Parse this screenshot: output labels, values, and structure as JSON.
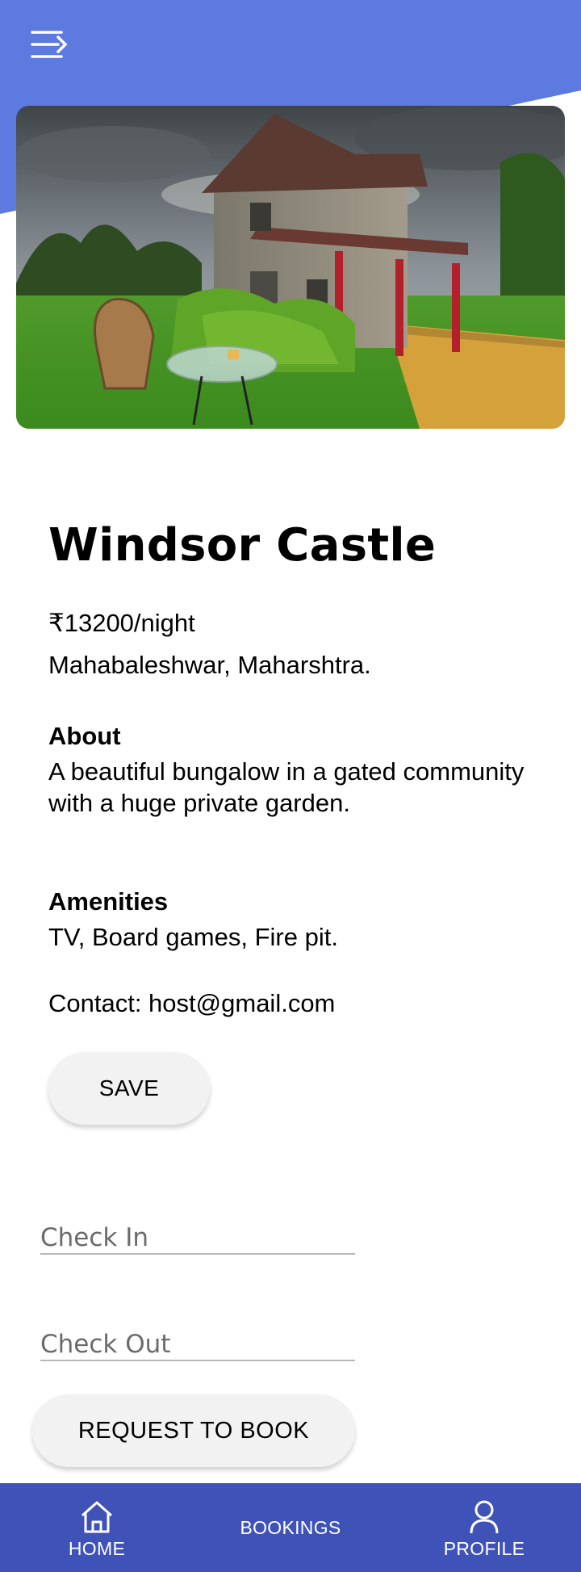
{
  "header": {
    "menu_icon": "menu-icon",
    "accent_color": "#5d7ae0"
  },
  "listing": {
    "title": "Windsor Castle",
    "price": "₹13200/night",
    "location": "Mahabaleshwar, Maharshtra.",
    "about_heading": "About",
    "about_text": "A beautiful bungalow in a gated community with a huge private garden.",
    "amenities_heading": "Amenities",
    "amenities_text": "TV, Board games, Fire pit.",
    "contact": "Contact: host@gmail.com"
  },
  "actions": {
    "save_label": "SAVE",
    "check_in_placeholder": "Check In",
    "check_out_placeholder": "Check Out",
    "request_label": "REQUEST TO BOOK"
  },
  "nav": {
    "background": "#3e52b8",
    "items": [
      {
        "label": "HOME",
        "icon": "home-icon"
      },
      {
        "label": "BOOKINGS",
        "icon": ""
      },
      {
        "label": "PROFILE",
        "icon": "user-icon"
      }
    ]
  }
}
